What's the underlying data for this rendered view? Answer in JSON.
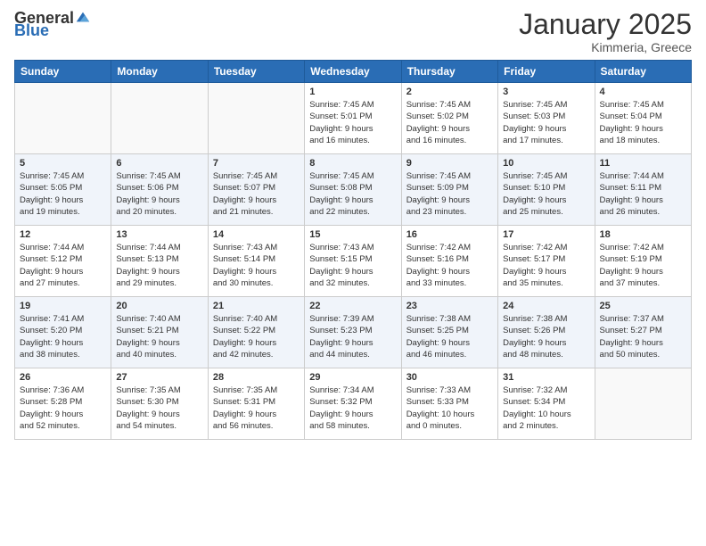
{
  "logo": {
    "general": "General",
    "blue": "Blue"
  },
  "header": {
    "month": "January 2025",
    "location": "Kimmeria, Greece"
  },
  "weekdays": [
    "Sunday",
    "Monday",
    "Tuesday",
    "Wednesday",
    "Thursday",
    "Friday",
    "Saturday"
  ],
  "weeks": [
    [
      {
        "day": "",
        "content": ""
      },
      {
        "day": "",
        "content": ""
      },
      {
        "day": "",
        "content": ""
      },
      {
        "day": "1",
        "content": "Sunrise: 7:45 AM\nSunset: 5:01 PM\nDaylight: 9 hours\nand 16 minutes."
      },
      {
        "day": "2",
        "content": "Sunrise: 7:45 AM\nSunset: 5:02 PM\nDaylight: 9 hours\nand 16 minutes."
      },
      {
        "day": "3",
        "content": "Sunrise: 7:45 AM\nSunset: 5:03 PM\nDaylight: 9 hours\nand 17 minutes."
      },
      {
        "day": "4",
        "content": "Sunrise: 7:45 AM\nSunset: 5:04 PM\nDaylight: 9 hours\nand 18 minutes."
      }
    ],
    [
      {
        "day": "5",
        "content": "Sunrise: 7:45 AM\nSunset: 5:05 PM\nDaylight: 9 hours\nand 19 minutes."
      },
      {
        "day": "6",
        "content": "Sunrise: 7:45 AM\nSunset: 5:06 PM\nDaylight: 9 hours\nand 20 minutes."
      },
      {
        "day": "7",
        "content": "Sunrise: 7:45 AM\nSunset: 5:07 PM\nDaylight: 9 hours\nand 21 minutes."
      },
      {
        "day": "8",
        "content": "Sunrise: 7:45 AM\nSunset: 5:08 PM\nDaylight: 9 hours\nand 22 minutes."
      },
      {
        "day": "9",
        "content": "Sunrise: 7:45 AM\nSunset: 5:09 PM\nDaylight: 9 hours\nand 23 minutes."
      },
      {
        "day": "10",
        "content": "Sunrise: 7:45 AM\nSunset: 5:10 PM\nDaylight: 9 hours\nand 25 minutes."
      },
      {
        "day": "11",
        "content": "Sunrise: 7:44 AM\nSunset: 5:11 PM\nDaylight: 9 hours\nand 26 minutes."
      }
    ],
    [
      {
        "day": "12",
        "content": "Sunrise: 7:44 AM\nSunset: 5:12 PM\nDaylight: 9 hours\nand 27 minutes."
      },
      {
        "day": "13",
        "content": "Sunrise: 7:44 AM\nSunset: 5:13 PM\nDaylight: 9 hours\nand 29 minutes."
      },
      {
        "day": "14",
        "content": "Sunrise: 7:43 AM\nSunset: 5:14 PM\nDaylight: 9 hours\nand 30 minutes."
      },
      {
        "day": "15",
        "content": "Sunrise: 7:43 AM\nSunset: 5:15 PM\nDaylight: 9 hours\nand 32 minutes."
      },
      {
        "day": "16",
        "content": "Sunrise: 7:42 AM\nSunset: 5:16 PM\nDaylight: 9 hours\nand 33 minutes."
      },
      {
        "day": "17",
        "content": "Sunrise: 7:42 AM\nSunset: 5:17 PM\nDaylight: 9 hours\nand 35 minutes."
      },
      {
        "day": "18",
        "content": "Sunrise: 7:42 AM\nSunset: 5:19 PM\nDaylight: 9 hours\nand 37 minutes."
      }
    ],
    [
      {
        "day": "19",
        "content": "Sunrise: 7:41 AM\nSunset: 5:20 PM\nDaylight: 9 hours\nand 38 minutes."
      },
      {
        "day": "20",
        "content": "Sunrise: 7:40 AM\nSunset: 5:21 PM\nDaylight: 9 hours\nand 40 minutes."
      },
      {
        "day": "21",
        "content": "Sunrise: 7:40 AM\nSunset: 5:22 PM\nDaylight: 9 hours\nand 42 minutes."
      },
      {
        "day": "22",
        "content": "Sunrise: 7:39 AM\nSunset: 5:23 PM\nDaylight: 9 hours\nand 44 minutes."
      },
      {
        "day": "23",
        "content": "Sunrise: 7:38 AM\nSunset: 5:25 PM\nDaylight: 9 hours\nand 46 minutes."
      },
      {
        "day": "24",
        "content": "Sunrise: 7:38 AM\nSunset: 5:26 PM\nDaylight: 9 hours\nand 48 minutes."
      },
      {
        "day": "25",
        "content": "Sunrise: 7:37 AM\nSunset: 5:27 PM\nDaylight: 9 hours\nand 50 minutes."
      }
    ],
    [
      {
        "day": "26",
        "content": "Sunrise: 7:36 AM\nSunset: 5:28 PM\nDaylight: 9 hours\nand 52 minutes."
      },
      {
        "day": "27",
        "content": "Sunrise: 7:35 AM\nSunset: 5:30 PM\nDaylight: 9 hours\nand 54 minutes."
      },
      {
        "day": "28",
        "content": "Sunrise: 7:35 AM\nSunset: 5:31 PM\nDaylight: 9 hours\nand 56 minutes."
      },
      {
        "day": "29",
        "content": "Sunrise: 7:34 AM\nSunset: 5:32 PM\nDaylight: 9 hours\nand 58 minutes."
      },
      {
        "day": "30",
        "content": "Sunrise: 7:33 AM\nSunset: 5:33 PM\nDaylight: 10 hours\nand 0 minutes."
      },
      {
        "day": "31",
        "content": "Sunrise: 7:32 AM\nSunset: 5:34 PM\nDaylight: 10 hours\nand 2 minutes."
      },
      {
        "day": "",
        "content": ""
      }
    ]
  ]
}
